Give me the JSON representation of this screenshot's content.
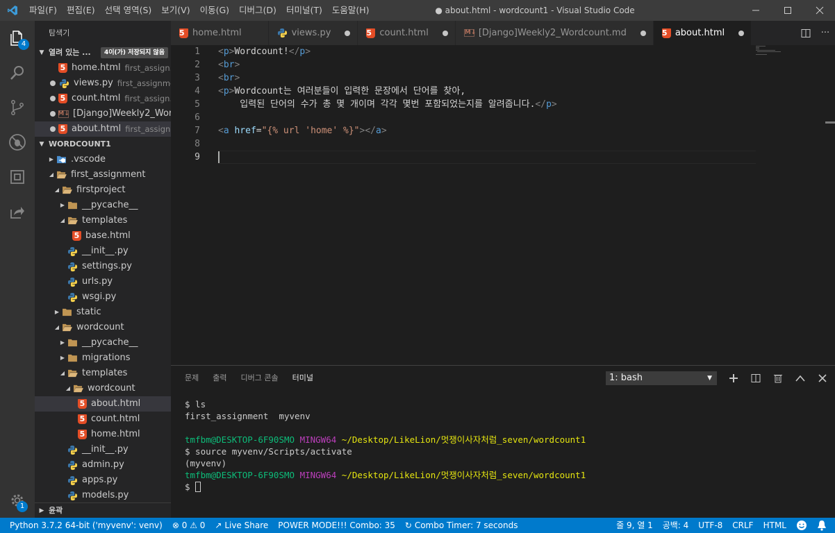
{
  "window": {
    "title": "● about.html - wordcount1 - Visual Studio Code",
    "menu": [
      "파일(F)",
      "편집(E)",
      "선택 영역(S)",
      "보기(V)",
      "이동(G)",
      "디버그(D)",
      "터미널(T)",
      "도움말(H)"
    ]
  },
  "activity": {
    "explorer_badge": "4",
    "settings_badge": "1"
  },
  "sidebar": {
    "title": "탐색기",
    "open_editors": {
      "label": "열려 있는 ...",
      "dirty_badge": "4이(가) 저장되지 않음",
      "items": [
        {
          "name": "home.html",
          "desc": "first_assign...",
          "kind": "html",
          "dirty": false
        },
        {
          "name": "views.py",
          "desc": "first_assignme...",
          "kind": "py",
          "dirty": true
        },
        {
          "name": "count.html",
          "desc": "first_assign...",
          "kind": "html",
          "dirty": true
        },
        {
          "name": "[Django]Weekly2_Wor...",
          "desc": "",
          "kind": "md",
          "dirty": true
        },
        {
          "name": "about.html",
          "desc": "first_assign...",
          "kind": "html",
          "dirty": true
        }
      ]
    },
    "folder": {
      "label": "WORDCOUNT1",
      "tree": [
        {
          "name": ".vscode",
          "depth": 1,
          "kind": "vscode-folder",
          "open": false
        },
        {
          "name": "first_assignment",
          "depth": 1,
          "kind": "folder",
          "open": true
        },
        {
          "name": "firstproject",
          "depth": 2,
          "kind": "folder",
          "open": true
        },
        {
          "name": "__pycache__",
          "depth": 3,
          "kind": "folder",
          "open": false
        },
        {
          "name": "templates",
          "depth": 3,
          "kind": "folder",
          "open": true
        },
        {
          "name": "base.html",
          "depth": 4,
          "kind": "html"
        },
        {
          "name": "__init__.py",
          "depth": 3,
          "kind": "py"
        },
        {
          "name": "settings.py",
          "depth": 3,
          "kind": "py"
        },
        {
          "name": "urls.py",
          "depth": 3,
          "kind": "py"
        },
        {
          "name": "wsgi.py",
          "depth": 3,
          "kind": "py"
        },
        {
          "name": "static",
          "depth": 2,
          "kind": "folder",
          "open": false
        },
        {
          "name": "wordcount",
          "depth": 2,
          "kind": "folder",
          "open": true
        },
        {
          "name": "__pycache__",
          "depth": 3,
          "kind": "folder",
          "open": false
        },
        {
          "name": "migrations",
          "depth": 3,
          "kind": "folder",
          "open": false
        },
        {
          "name": "templates",
          "depth": 3,
          "kind": "folder",
          "open": true
        },
        {
          "name": "wordcount",
          "depth": 4,
          "kind": "folder",
          "open": true
        },
        {
          "name": "about.html",
          "depth": 5,
          "kind": "html",
          "selected": true
        },
        {
          "name": "count.html",
          "depth": 5,
          "kind": "html"
        },
        {
          "name": "home.html",
          "depth": 5,
          "kind": "html"
        },
        {
          "name": "__init__.py",
          "depth": 3,
          "kind": "py"
        },
        {
          "name": "admin.py",
          "depth": 3,
          "kind": "py"
        },
        {
          "name": "apps.py",
          "depth": 3,
          "kind": "py"
        },
        {
          "name": "models.py",
          "depth": 3,
          "kind": "py"
        }
      ]
    },
    "outline_label": "윤곽"
  },
  "tabs": [
    {
      "name": "home.html",
      "kind": "html",
      "dirty": false,
      "active": false
    },
    {
      "name": "views.py",
      "kind": "py",
      "dirty": true,
      "active": false
    },
    {
      "name": "count.html",
      "kind": "html",
      "dirty": true,
      "active": false
    },
    {
      "name": "[Django]Weekly2_Wordcount.md",
      "kind": "md",
      "dirty": true,
      "active": false
    },
    {
      "name": "about.html",
      "kind": "html",
      "dirty": true,
      "active": true
    }
  ],
  "editor": {
    "current_line": 9,
    "lines": [
      {
        "n": "1",
        "tokens": [
          [
            "brk",
            "<"
          ],
          [
            "tag",
            "p"
          ],
          [
            "brk",
            ">"
          ],
          [
            "txt",
            "Wordcount!"
          ],
          [
            "brk",
            "</"
          ],
          [
            "tag",
            "p"
          ],
          [
            "brk",
            ">"
          ]
        ]
      },
      {
        "n": "2",
        "tokens": [
          [
            "brk",
            "<"
          ],
          [
            "tag",
            "br"
          ],
          [
            "brk",
            ">"
          ]
        ]
      },
      {
        "n": "3",
        "tokens": [
          [
            "brk",
            "<"
          ],
          [
            "tag",
            "br"
          ],
          [
            "brk",
            ">"
          ]
        ]
      },
      {
        "n": "4",
        "tokens": [
          [
            "brk",
            "<"
          ],
          [
            "tag",
            "p"
          ],
          [
            "brk",
            ">"
          ],
          [
            "txt",
            "Wordcount는 여러분들이 입력한 문장에서 단어를 찾아,"
          ]
        ]
      },
      {
        "n": "5",
        "tokens": [
          [
            "txt",
            "    입력된 단어의 수가 총 몇 개이며 각각 몇번 포함되었는지를 알려줍니다."
          ],
          [
            "brk",
            "</"
          ],
          [
            "tag",
            "p"
          ],
          [
            "brk",
            ">"
          ]
        ]
      },
      {
        "n": "6",
        "tokens": []
      },
      {
        "n": "7",
        "tokens": [
          [
            "brk",
            "<"
          ],
          [
            "tag",
            "a"
          ],
          [
            "txt",
            " "
          ],
          [
            "attr",
            "href"
          ],
          [
            "txt",
            "="
          ],
          [
            "str",
            "\"{% url 'home' %}\""
          ],
          [
            "brk",
            "></"
          ],
          [
            "tag",
            "a"
          ],
          [
            "brk",
            ">"
          ]
        ]
      },
      {
        "n": "8",
        "tokens": []
      },
      {
        "n": "9",
        "tokens": []
      }
    ]
  },
  "panel": {
    "tabs": [
      "문제",
      "출력",
      "디버그 콘솔",
      "터미널"
    ],
    "active_tab": "터미널",
    "terminal_select": "1: bash",
    "terminal_lines": [
      [
        [
          "txt",
          "$ ls"
        ]
      ],
      [
        [
          "txt",
          "first_assignment  myvenv"
        ]
      ],
      [
        [
          "txt",
          ""
        ]
      ],
      [
        [
          "g",
          "tmfbm@DESKTOP-6F90SMO"
        ],
        [
          "txt",
          " "
        ],
        [
          "m",
          "MINGW64"
        ],
        [
          "txt",
          " "
        ],
        [
          "y",
          "~/Desktop/LikeLion/멋쟁이사자처럼_seven/wordcount1"
        ]
      ],
      [
        [
          "txt",
          "$ source myvenv/Scripts/activate"
        ]
      ],
      [
        [
          "txt",
          "(myvenv)"
        ]
      ],
      [
        [
          "g",
          "tmfbm@DESKTOP-6F90SMO"
        ],
        [
          "txt",
          " "
        ],
        [
          "m",
          "MINGW64"
        ],
        [
          "txt",
          " "
        ],
        [
          "y",
          "~/Desktop/LikeLion/멋쟁이사자처럼_seven/wordcount1"
        ]
      ],
      [
        [
          "txt",
          "$ "
        ],
        [
          "cursor",
          ""
        ]
      ]
    ]
  },
  "status": {
    "python": "Python 3.7.2 64-bit ('myvenv': venv)",
    "errors": "0",
    "warnings": "0",
    "live_share": "Live Share",
    "power_mode": "POWER MODE!!! Combo: 35",
    "combo_timer": "Combo Timer: 7 seconds",
    "position": "줄 9, 열 1",
    "spaces": "공백: 4",
    "encoding": "UTF-8",
    "eol": "CRLF",
    "language": "HTML"
  }
}
